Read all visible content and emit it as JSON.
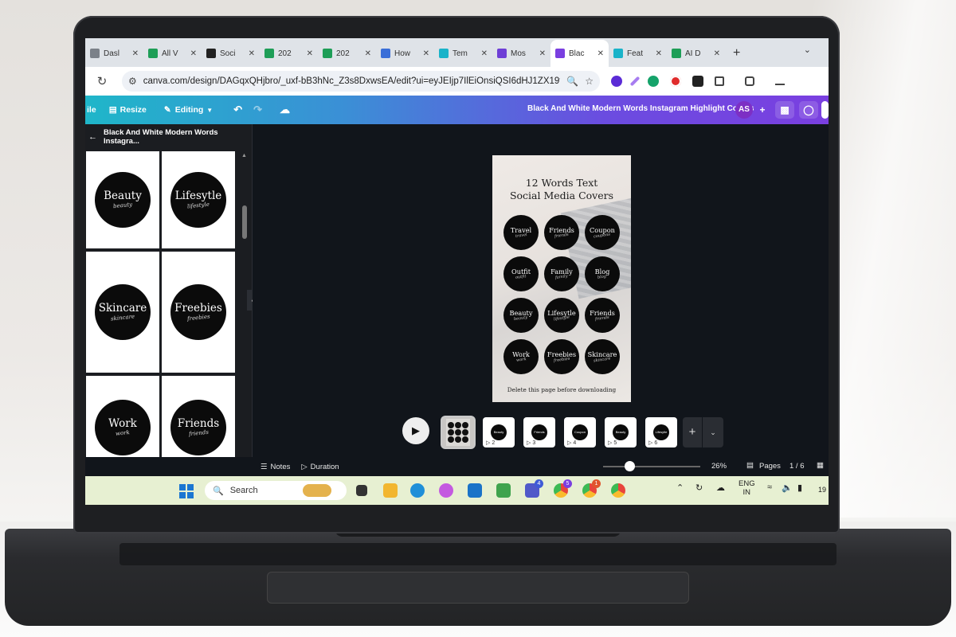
{
  "browser": {
    "tabs": [
      {
        "label": "Dasl",
        "color": "#7b8189"
      },
      {
        "label": "All V",
        "color": "#1e9e57"
      },
      {
        "label": "Soci",
        "color": "#222222"
      },
      {
        "label": "202",
        "color": "#1e9e57"
      },
      {
        "label": "202",
        "color": "#1e9e57"
      },
      {
        "label": "How",
        "color": "#3b6fd8"
      },
      {
        "label": "Tem",
        "color": "#1ab3c9"
      },
      {
        "label": "Mos",
        "color": "#6e3fd6"
      },
      {
        "label": "Blac",
        "color": "#7a3fe0",
        "active": true
      },
      {
        "label": "Feat",
        "color": "#1ab3c9"
      },
      {
        "label": "AI D",
        "color": "#1e9e57"
      }
    ],
    "url": "canva.com/design/DAGqxQHjbro/_uxf-bB3hNc_Z3s8DxwsEA/edit?ui=eyJEIjp7IlEiOnsiQSI6dHJ1ZX19fQ"
  },
  "canva_header": {
    "file_label": "ile",
    "resize_label": "Resize",
    "editing_label": "Editing",
    "design_title": "Black And White Modern Words Instagram Highlight Covers",
    "avatar_initials": "AS"
  },
  "panel": {
    "title": "Black And White Modern Words Instagra...",
    "cards": [
      {
        "word": "Beauty",
        "script": "beauty"
      },
      {
        "word": "Lifesytle",
        "script": "lifestyle"
      },
      {
        "word": "Skincare",
        "script": "skincare"
      },
      {
        "word": "Freebies",
        "script": "freebies"
      },
      {
        "word": "Work",
        "script": "work"
      },
      {
        "word": "Friends",
        "script": "friends"
      }
    ]
  },
  "page": {
    "title_line1": "12 Words Text",
    "title_line2": "Social Media Covers",
    "circles": [
      {
        "word": "Travel",
        "script": "travel"
      },
      {
        "word": "Friends",
        "script": "friends"
      },
      {
        "word": "Coupon",
        "script": "coupons"
      },
      {
        "word": "Outfit",
        "script": "outfit"
      },
      {
        "word": "Family",
        "script": "family"
      },
      {
        "word": "Blog",
        "script": "blog"
      },
      {
        "word": "Beauty",
        "script": "beauty"
      },
      {
        "word": "Lifesytle",
        "script": "lifestyle"
      },
      {
        "word": "Friends",
        "script": "friends"
      },
      {
        "word": "Work",
        "script": "work"
      },
      {
        "word": "Freebies",
        "script": "freebies"
      },
      {
        "word": "Skincare",
        "script": "skincare"
      }
    ],
    "footer": "Delete this page before downloading"
  },
  "pages_strip": {
    "thumbs": [
      {
        "num": "2",
        "word": "Beauty"
      },
      {
        "num": "3",
        "word": "Friends"
      },
      {
        "num": "4",
        "word": "Coupon"
      },
      {
        "num": "5",
        "word": "Beauty"
      },
      {
        "num": "6",
        "word": "Lifesytle"
      }
    ]
  },
  "bottom_bar": {
    "notes_label": "Notes",
    "duration_label": "Duration",
    "zoom": "26%",
    "pages_label": "Pages",
    "page_count": "1 / 6"
  },
  "taskbar": {
    "search_placeholder": "Search",
    "lang_line1": "ENG",
    "lang_line2": "IN",
    "clock_fragment": "19",
    "badges": [
      "4",
      "5",
      "1"
    ]
  }
}
